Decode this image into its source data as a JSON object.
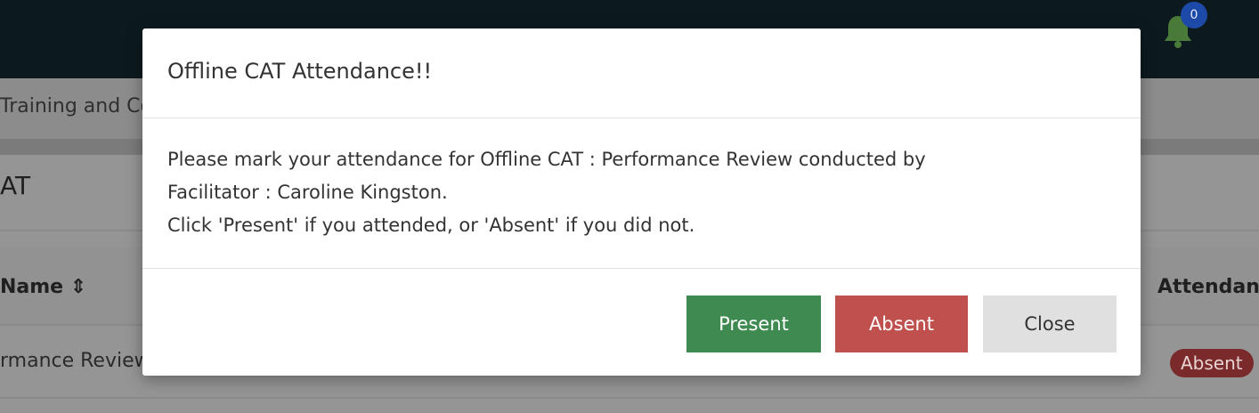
{
  "header": {
    "notification_count": "0"
  },
  "breadcrumb": {
    "text": "Training and Co"
  },
  "panel": {
    "title": "AT",
    "columns": {
      "name": "Name ⇕",
      "attendance": "Attendanc"
    },
    "row": {
      "name": "rmance Review",
      "attendance_badge": "Absent"
    }
  },
  "modal": {
    "title": "Offline CAT Attendance!!",
    "body_line1": "Please mark your attendance for Offline CAT : Performance Review conducted by",
    "body_line2": "Facilitator : Caroline Kingston.",
    "body_line3": "Click 'Present' if you attended, or 'Absent' if you did not.",
    "buttons": {
      "present": "Present",
      "absent": "Absent",
      "close": "Close"
    }
  },
  "colors": {
    "present": "#3e8a50",
    "absent": "#c0504e",
    "close": "#e0e0e0",
    "topbar": "#0c1a1f",
    "badge": "#1d4aa8"
  }
}
